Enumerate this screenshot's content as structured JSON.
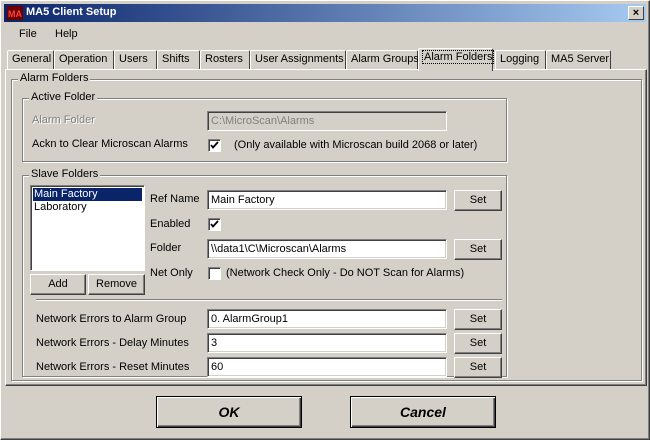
{
  "window": {
    "title": "MA5 Client Setup",
    "close_glyph": "×"
  },
  "menu": {
    "items": [
      "File",
      "Help"
    ]
  },
  "tabs": [
    "General",
    "Operation",
    "Users",
    "Shifts",
    "Rosters",
    "User Assignments",
    "Alarm Groups",
    "Alarm Folders",
    "Logging",
    "MA5 Server"
  ],
  "active_tab": "Alarm Folders",
  "alarm_folders": {
    "group_title": "Alarm Folders",
    "active_folder": {
      "title": "Active Folder",
      "folder_label": "Alarm Folder",
      "folder_value": "C:\\MicroScan\\Alarms",
      "ackn_label": "Ackn to Clear Microscan Alarms",
      "ackn_checked": true,
      "ackn_note": "(Only available with Microscan build 2068 or later)"
    },
    "slave_folders": {
      "title": "Slave Folders",
      "list": [
        "Main Factory",
        "Laboratory"
      ],
      "selected": "Main Factory",
      "add_label": "Add",
      "remove_label": "Remove",
      "ref_name_label": "Ref Name",
      "ref_name_value": "Main Factory",
      "enabled_label": "Enabled",
      "enabled_checked": true,
      "folder_label": "Folder",
      "folder_value": "\\\\data1\\C\\Microscan\\Alarms",
      "net_only_label": "Net Only",
      "net_only_checked": false,
      "net_only_note": "(Network Check Only - Do NOT Scan for Alarms)",
      "set_label": "Set",
      "net_errors_group_label": "Network Errors to Alarm Group",
      "net_errors_group_value": "0. AlarmGroup1",
      "delay_label": "Network Errors - Delay Minutes",
      "delay_value": "3",
      "reset_label": "Network Errors - Reset Minutes",
      "reset_value": "60"
    }
  },
  "buttons": {
    "ok": "OK",
    "cancel": "Cancel"
  },
  "colors": {
    "title_start": "#0a246a",
    "title_end": "#a6caf0",
    "face": "#d4d0c8",
    "selection": "#0a246a"
  }
}
